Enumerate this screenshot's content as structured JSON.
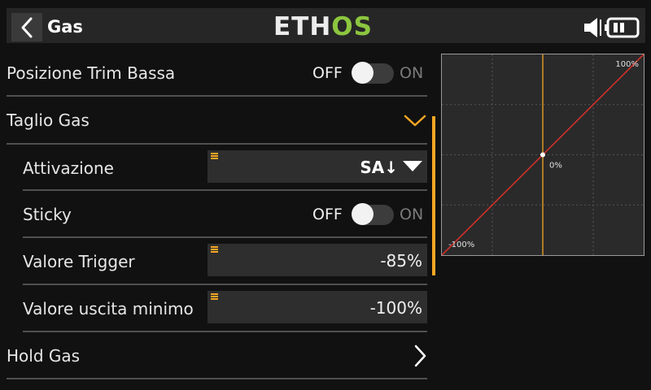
{
  "header": {
    "title": "Gas",
    "logo_main": "ETH",
    "logo_accent": "OS"
  },
  "colors": {
    "accent": "#f5a623",
    "brand_green": "#8cc63f",
    "curve": "#d0302a"
  },
  "icons": [
    "back-arrow-icon",
    "speaker-icon",
    "battery-icon",
    "chevron-down-icon",
    "chevron-right-icon",
    "dropdown-triangle-icon",
    "drag-handle-icon"
  ],
  "rows": {
    "trim": {
      "label": "Posizione Trim Bassa",
      "off": "OFF",
      "on": "ON",
      "state": false
    },
    "cut": {
      "label": "Taglio Gas"
    },
    "activation": {
      "label": "Attivazione",
      "value": "SA↓"
    },
    "sticky": {
      "label": "Sticky",
      "off": "OFF",
      "on": "ON",
      "state": false
    },
    "trigger": {
      "label": "Valore Trigger",
      "value": "-85%"
    },
    "min_output": {
      "label": "Valore uscita minimo",
      "value": "-100%"
    },
    "hold": {
      "label": "Hold Gas"
    }
  },
  "chart_data": {
    "type": "line",
    "x": [
      -100,
      100
    ],
    "series": [
      {
        "values": [
          -100,
          100
        ]
      }
    ],
    "xlim": [
      -100,
      100
    ],
    "ylim": [
      -100,
      100
    ],
    "labels": {
      "top_right": "100%",
      "center": "0%",
      "bottom_left": "-100%"
    },
    "cursor_x": 0,
    "grid": true
  }
}
